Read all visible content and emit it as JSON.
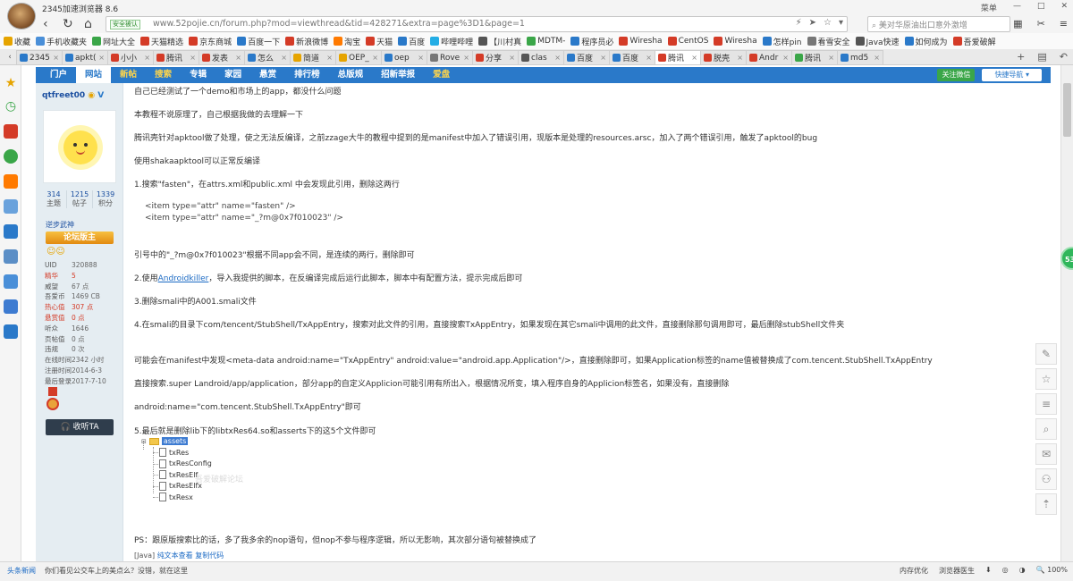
{
  "browser": {
    "app_title": "2345加速浏览器 8.6",
    "window_controls": [
      "菜单",
      "—",
      "□",
      "✕"
    ],
    "secure_label": "安全被认",
    "url": "www.52pojie.cn/forum.php?mod=viewthread&tid=428271&extra=page%3D1&page=1",
    "search_placeholder": "美对华原油出口意外激增",
    "bookmarks": [
      {
        "label": "收藏",
        "color": "#e6a400"
      },
      {
        "label": "手机收藏夹",
        "color": "#4a8fd8"
      },
      {
        "label": "网址大全",
        "color": "#3aa648"
      },
      {
        "label": "天猫精选",
        "color": "#d43b27"
      },
      {
        "label": "京东商城",
        "color": "#d43b27"
      },
      {
        "label": "百度一下",
        "color": "#2a79c9"
      },
      {
        "label": "新浪微博",
        "color": "#d43b27"
      },
      {
        "label": "淘宝",
        "color": "#ff7a00"
      },
      {
        "label": "天猫",
        "color": "#d43b27"
      },
      {
        "label": "百度",
        "color": "#2a79c9"
      },
      {
        "label": "哔哩哔哩",
        "color": "#23ade5"
      },
      {
        "label": "【川村真",
        "color": "#555555"
      },
      {
        "label": "MDTM-",
        "color": "#3aa648"
      },
      {
        "label": "程序员必",
        "color": "#2a79c9"
      },
      {
        "label": "Wiresha",
        "color": "#d43b27"
      },
      {
        "label": "CentOS",
        "color": "#d43b27"
      },
      {
        "label": "Wiresha",
        "color": "#d43b27"
      },
      {
        "label": "怎样pin",
        "color": "#2a79c9"
      },
      {
        "label": "看雪安全",
        "color": "#777777"
      },
      {
        "label": "Java快速",
        "color": "#555555"
      },
      {
        "label": "如何成为",
        "color": "#2a79c9"
      },
      {
        "label": "吾爱破解",
        "color": "#d43b27"
      }
    ],
    "tabs": [
      {
        "label": "2345",
        "color": "#2a79c9",
        "active": false
      },
      {
        "label": "apkt(",
        "color": "#2a79c9",
        "active": false
      },
      {
        "label": "小小",
        "color": "#d43b27",
        "active": false
      },
      {
        "label": "腾讯",
        "color": "#d43b27",
        "active": false
      },
      {
        "label": "发表",
        "color": "#d43b27",
        "active": false
      },
      {
        "label": "怎么",
        "color": "#2a79c9",
        "active": false
      },
      {
        "label": "简道",
        "color": "#e6a400",
        "active": false
      },
      {
        "label": "OEP_",
        "color": "#e6a400",
        "active": false
      },
      {
        "label": "oep",
        "color": "#2a79c9",
        "active": false
      },
      {
        "label": "Rove",
        "color": "#777777",
        "active": false
      },
      {
        "label": "分享",
        "color": "#d43b27",
        "active": false
      },
      {
        "label": "clas",
        "color": "#555555",
        "active": false
      },
      {
        "label": "百度",
        "color": "#2a79c9",
        "active": false
      },
      {
        "label": "百度",
        "color": "#2a79c9",
        "active": false
      },
      {
        "label": "腾讯",
        "color": "#d43b27",
        "active": true
      },
      {
        "label": "脱壳",
        "color": "#d43b27",
        "active": false
      },
      {
        "label": "Andr",
        "color": "#d43b27",
        "active": false
      },
      {
        "label": "腾讯",
        "color": "#3aa648",
        "active": false
      },
      {
        "label": "md5",
        "color": "#2a79c9",
        "active": false
      }
    ]
  },
  "forum_nav": {
    "items": [
      {
        "label": "门户",
        "active": false,
        "hot": false
      },
      {
        "label": "网站",
        "active": true,
        "hot": false
      },
      {
        "label": "新帖",
        "active": false,
        "hot": true
      },
      {
        "label": "搜索",
        "active": false,
        "hot": true
      },
      {
        "label": "专辑",
        "active": false,
        "hot": false
      },
      {
        "label": "家园",
        "active": false,
        "hot": false
      },
      {
        "label": "悬赏",
        "active": false,
        "hot": false
      },
      {
        "label": "排行榜",
        "active": false,
        "hot": false
      },
      {
        "label": "总版规",
        "active": false,
        "hot": false
      },
      {
        "label": "招新举报",
        "active": false,
        "hot": false
      },
      {
        "label": "爱盘",
        "active": false,
        "hot": true
      }
    ],
    "follow_label": "关注微信",
    "quicknav_label": "快捷导航 ▾"
  },
  "profile": {
    "username": "qtfreet00",
    "stats": [
      {
        "num": "314",
        "label": "主题"
      },
      {
        "num": "1215",
        "label": "帖子"
      },
      {
        "num": "1339",
        "label": "积分"
      }
    ],
    "rank_text": "逆步武神",
    "rank_badge": "论坛版主",
    "smileys": "☺☺",
    "info": [
      {
        "k": "UID",
        "v": "320888",
        "red": false
      },
      {
        "k": "精华",
        "v": "5",
        "red": true
      },
      {
        "k": "威望",
        "v": "67 点",
        "red": false
      },
      {
        "k": "吾爱币",
        "v": "1469 CB",
        "red": false
      },
      {
        "k": "热心值",
        "v": "307 点",
        "red": true
      },
      {
        "k": "悬赏值",
        "v": "0 点",
        "red": true
      },
      {
        "k": "听众",
        "v": "1646",
        "red": false
      },
      {
        "k": "页帖值",
        "v": "0 点",
        "red": false
      },
      {
        "k": "违规",
        "v": "0 次",
        "red": false
      },
      {
        "k": "在线时间",
        "v": "2342 小时",
        "red": false
      },
      {
        "k": "注册时间",
        "v": "2014-6-3",
        "red": false
      },
      {
        "k": "最后登录",
        "v": "2017-7-10",
        "red": false
      }
    ],
    "listen_label": "收听TA"
  },
  "post": {
    "line1": "自己已经测试了一个demo和市场上的app，都没什么问题",
    "line2": "本教程不说原理了，自己根据我做的去理解一下",
    "line3": "腾讯壳针对apktool做了处理，使之无法反编译，之前zzage大牛的教程中提到的是manifest中加入了错误引用，现版本是处理的resources.arsc，加入了两个错误引用，触发了apktool的bug",
    "line4": "使用shakaapktool可以正常反编译",
    "line5": "1.搜索\"fasten\"，在attrs.xml和public.xml 中会发现此引用，删除这两行",
    "code1": "<item type=\"attr\" name=\"fasten\" />",
    "code2": "<item type=\"attr\" name=\"_?m@0x7f010023\" />",
    "line6": "引号中的\"_?m@0x7f010023\"根据不同app会不同，是连续的两行，删除即可",
    "line7_pre": "2.使用",
    "line7_link": "Androidkiller",
    "line7_post": "，导入我提供的脚本，在反编译完成后运行此脚本，脚本中有配置方法，提示完成后即可",
    "line8": "3.删除smali中的A001.smali文件",
    "line9": "4.在smali的目录下com/tencent/StubShell/TxAppEntry，搜索对此文件的引用，直接搜索TxAppEntry，如果发现在其它smali中调用的此文件，直接删除那句调用即可，最后删除stubShell文件夹",
    "line10": "可能会在manifest中发现<meta-data android:name=\"TxAppEntry\" android:value=\"android.app.Application\"/>，直接删除即可，如果Application标签的name值被替换成了com.tencent.StubShell.TxAppEntry",
    "line11": "直接搜索.super Landroid/app/application，部分app的自定义Applicion可能引用有所出入，根据情况所变，填入程序自身的Applicion标签名，如果没有，直接删除",
    "line12": "android:name=\"com.tencent.StubShell.TxAppEntry\"即可",
    "line13": "5.最后就是删除lib下的libtxRes64.so和asserts下的这5个文件即可",
    "tree_root": "assets",
    "tree_files": [
      "txRes",
      "txResConfig",
      "txResElf",
      "txResElfx",
      "txResx"
    ],
    "watermark": "吾爱破解论坛",
    "ps": "PS：跟原版搜索比的话，多了我多余的nop语句，但nop不参与程序逻辑，所以无影响，其次部分语句被替换成了",
    "tags_prefix": "[Java]",
    "tags_links": "纯文本查看 复制代码"
  },
  "float_badge": "53",
  "right_tools": [
    "✎",
    "☆",
    "≡",
    "⌕",
    "✉",
    "⚇",
    "⇡"
  ],
  "statusbar": {
    "news_label": "头条新闻",
    "news_text": "你们看见公交车上的美点么？没错，就在这里",
    "right_items": [
      "内存优化",
      "浏览器医生",
      "⬇",
      "◎",
      "◑",
      "🔍 100%"
    ]
  }
}
